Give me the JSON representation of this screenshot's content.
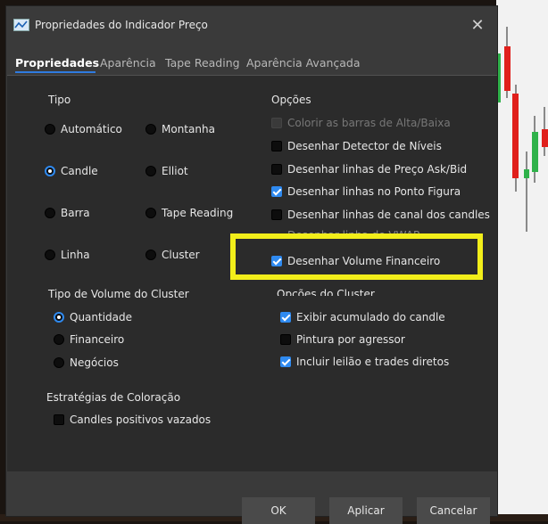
{
  "window": {
    "title": "Propriedades do Indicador Preço",
    "close_symbol": "✕"
  },
  "tabs": [
    "Propriedades",
    "Aparência",
    "Tape Reading",
    "Aparência Avançada"
  ],
  "tipo": {
    "heading": "Tipo",
    "options": [
      "Automático",
      "Montanha",
      "Candle",
      "Elliot",
      "Barra",
      "Tape Reading",
      "Linha",
      "Cluster"
    ],
    "selected": "Candle"
  },
  "opcoes": {
    "heading": "Opções",
    "items": [
      {
        "label": "Colorir as barras de Alta/Baixa",
        "checked": false,
        "disabled": true
      },
      {
        "label": "Desenhar Detector de Níveis",
        "checked": false,
        "disabled": false
      },
      {
        "label": "Desenhar linhas de Preço Ask/Bid",
        "checked": false,
        "disabled": false
      },
      {
        "label": "Desenhar linhas no Ponto Figura",
        "checked": true,
        "disabled": false
      },
      {
        "label": "Desenhar linhas de canal dos candles",
        "checked": false,
        "disabled": false
      },
      {
        "label": "Desenhar linha de VWAP",
        "checked": false,
        "disabled": false
      },
      {
        "label": "Desenhar Volume Financeiro",
        "checked": true,
        "disabled": false
      }
    ]
  },
  "volume_cluster": {
    "heading": "Tipo de Volume do Cluster",
    "options": [
      "Quantidade",
      "Financeiro",
      "Negócios"
    ],
    "selected": "Quantidade"
  },
  "opcoes_cluster": {
    "heading": "Opções do Cluster",
    "items": [
      {
        "label": "Exibir acumulado do candle",
        "checked": true
      },
      {
        "label": "Pintura por agressor",
        "checked": false
      },
      {
        "label": "Incluir leilão e trades diretos",
        "checked": true
      }
    ]
  },
  "estrategias": {
    "heading": "Estratégias de Coloração",
    "items": [
      {
        "label": "Candles positivos vazados",
        "checked": false
      }
    ]
  },
  "buttons": {
    "ok": "OK",
    "apply": "Aplicar",
    "cancel": "Cancelar"
  },
  "colors": {
    "accent": "#2f8af0",
    "highlight": "#f2ee1a",
    "bull": "#2fb24a",
    "bear": "#e0201c"
  }
}
